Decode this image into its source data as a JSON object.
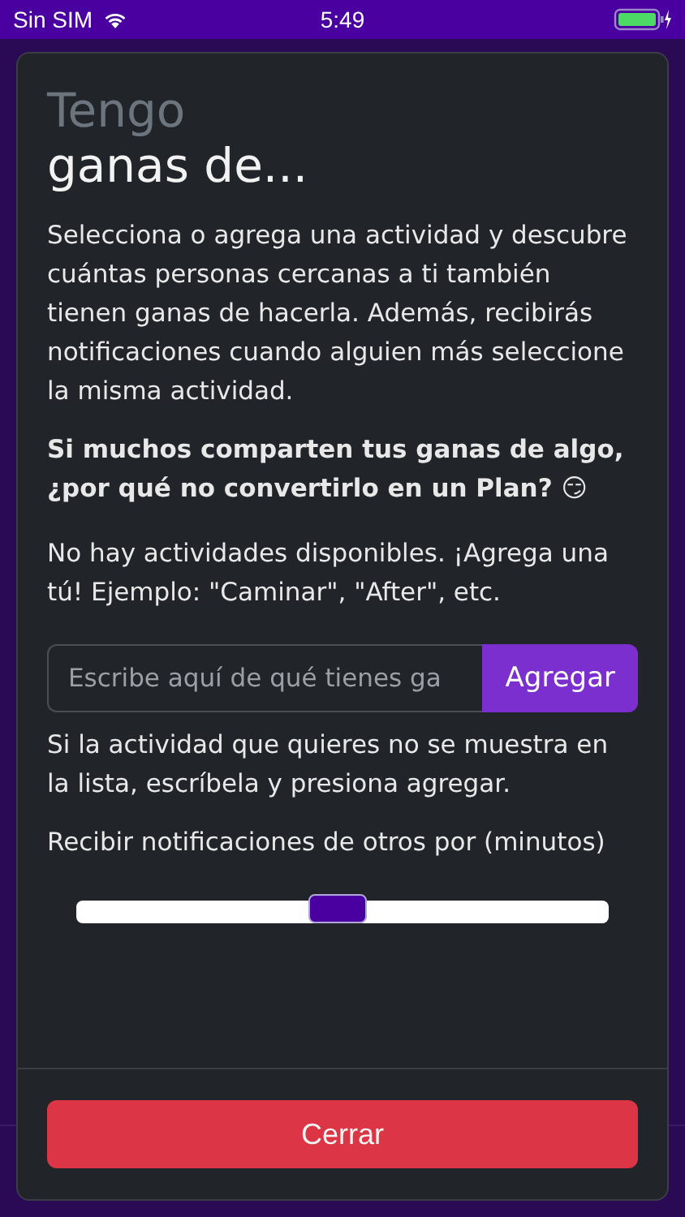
{
  "status_bar": {
    "carrier": "Sin SIM",
    "time": "5:49"
  },
  "modal": {
    "title_light": "Tengo",
    "title": "ganas de...",
    "description": "Selecciona o agrega una actividad y descubre cuántas personas cercanas a ti también tienen ganas de hacerla. Además, recibirás notificaciones cuando alguien más seleccione la misma actividad.",
    "highlight": "Si muchos comparten tus ganas de algo, ¿por qué no convertirlo en un Plan? 😏",
    "empty_message": "No hay actividades disponibles. ¡Agrega una tú! Ejemplo: \"Caminar\", \"After\", etc.",
    "activity_field": {
      "placeholder": "Escribe aquí de qué tienes ga"
    },
    "add_button": "Agregar",
    "hint": "Si la actividad que quieres no se muestra en la lista, escríbela y presiona agregar.",
    "slider_label": "Recibir notificaciones de otros por (minutos)",
    "slider": {
      "level": 0.49
    },
    "close_button": "Cerrar"
  }
}
